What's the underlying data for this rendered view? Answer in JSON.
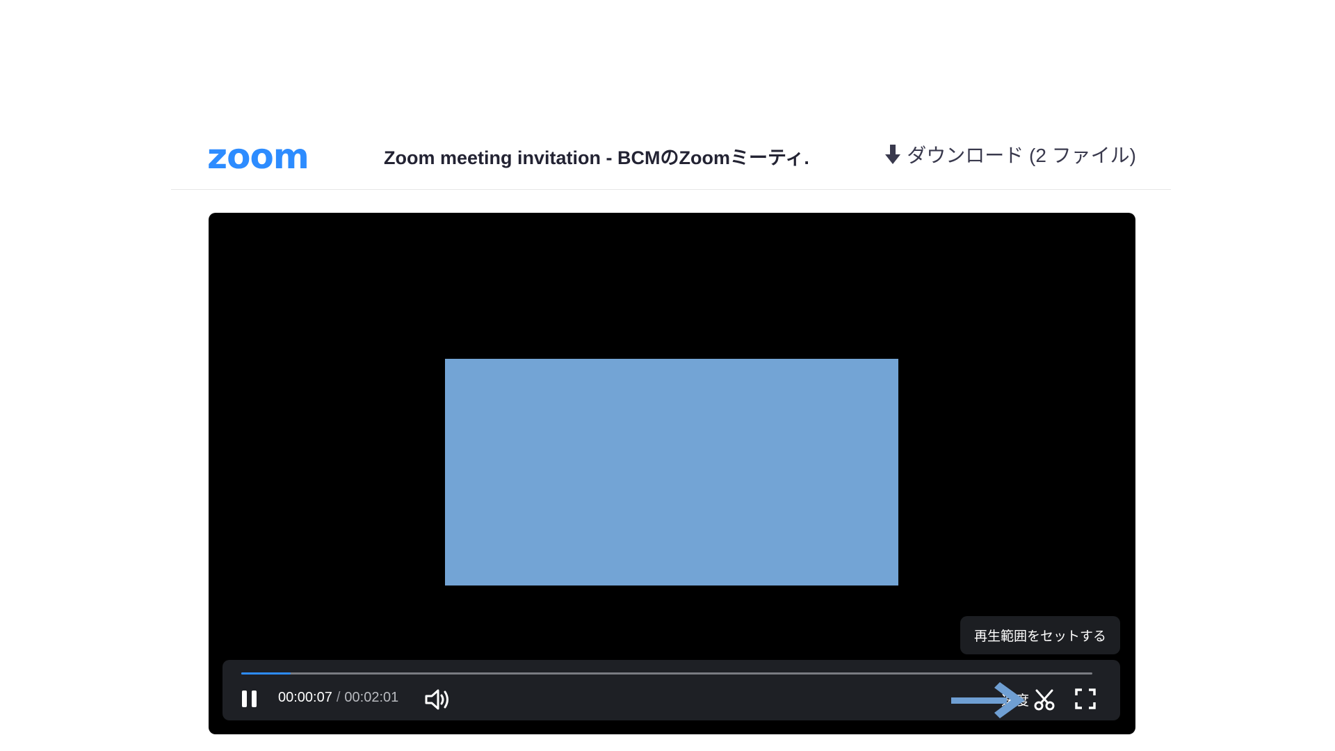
{
  "header": {
    "logo": "zoom",
    "title": "Zoom meeting invitation - BCMのZoomミーティ...",
    "download_label": "ダウンロード (2 ファイル)"
  },
  "player": {
    "current_time": "00:00:07",
    "time_separator": "/",
    "duration": "00:02:01",
    "progress_fraction": 0.058,
    "speed_label": "速度",
    "tooltip": "再生範囲をセットする",
    "video_frame_color": "#73a4d5",
    "accent_color": "#2d8cff",
    "annotation_arrow_color": "#6f9fd3",
    "icons": {
      "pause": "pause-icon",
      "volume": "volume-icon",
      "trim": "scissors-icon",
      "fullscreen": "fullscreen-icon",
      "download": "download-arrow-icon"
    }
  }
}
